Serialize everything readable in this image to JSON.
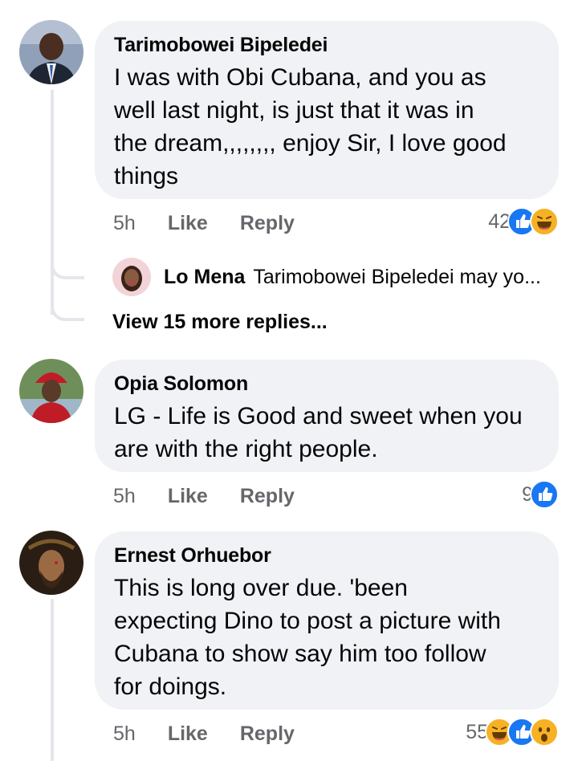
{
  "comments": [
    {
      "author": "Tarimobowei Bipeledei",
      "text_lines": [
        "I was with Obi Cubana, and you as",
        "well last night, is just that it was in",
        "the dream,,,,,,,, enjoy Sir, I love good",
        "things"
      ],
      "time": "5h",
      "like": "Like",
      "reply": "Reply",
      "reaction_count": "42",
      "reactions": [
        "like-icon",
        "haha-icon"
      ],
      "reply_preview": {
        "author": "Lo Mena",
        "text": "Tarimobowei Bipeledei may yo..."
      },
      "view_more": "View 15 more replies..."
    },
    {
      "author": "Opia Solomon",
      "text_lines": [
        "LG - Life is Good and sweet when you",
        "are with the right people."
      ],
      "time": "5h",
      "like": "Like",
      "reply": "Reply",
      "reaction_count": "9",
      "reactions": [
        "like-icon"
      ]
    },
    {
      "author": "Ernest Orhuebor",
      "text_lines": [
        "This is long over due. 'been",
        "expecting Dino to post a picture with",
        "Cubana to show say him too follow",
        "for doings."
      ],
      "time": "5h",
      "like": "Like",
      "reply": "Reply",
      "reaction_count": "55",
      "reactions": [
        "haha-icon",
        "like-icon",
        "wow-icon"
      ]
    }
  ],
  "colors": {
    "like": "#1877f2",
    "haha": "#f7b125",
    "wow": "#f7b125",
    "bubble": "#f0f2f5",
    "meta": "#65676b"
  }
}
